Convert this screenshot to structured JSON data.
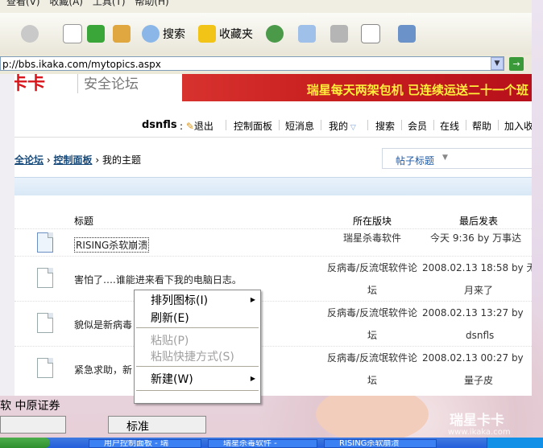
{
  "browser": {
    "toolbar": {
      "search_label": "搜索",
      "favorites_label": "收藏夹"
    },
    "address": "p://bbs.ikaka.com/mytopics.aspx",
    "address_full": "http://bbs.ikaka.com/mytopics.aspx",
    "go_label": "→"
  },
  "site": {
    "logo_red": "卡卡",
    "logo_text": "安全论坛",
    "banner_text": "瑞星每天两架包机 已连续运送二十一个班"
  },
  "nav": {
    "username": "dsnfls",
    "logout": "退出",
    "control_panel": "控制面板",
    "messages": "短消息",
    "mine": "我的",
    "search": "搜索",
    "members": "会员",
    "online": "在线",
    "help": "帮助",
    "join": "加入收"
  },
  "breadcrumb": {
    "forum": "全论坛",
    "control_panel": "控制面板",
    "current": "我的主题"
  },
  "topic_select": {
    "label": "帖子标题"
  },
  "table": {
    "headers": {
      "title": "标题",
      "forum": "所在版块",
      "last_post": "最后发表"
    },
    "rows": [
      {
        "title": "RISING杀软崩溃",
        "forum": "瑞星杀毒软件",
        "date": "今天 9:36",
        "by": "by",
        "author": "万事达",
        "forum_line2": "",
        "author_line2": ""
      },
      {
        "title": "害怕了….谁能进来看下我的电脑日志。",
        "forum": "反病毒/反流氓软件论",
        "forum_line2": "坛",
        "date": "2008.02.13 18:58",
        "by": "by",
        "author": "无",
        "author_line2": "月来了"
      },
      {
        "title": "貌似是新病毒",
        "forum": "反病毒/反流氓软件论",
        "forum_line2": "坛",
        "date": "2008.02.13 13:27",
        "by": "by",
        "author": "",
        "author_line2": "dsnfls"
      },
      {
        "title": "紧急求助，新",
        "forum": "反病毒/反流氓软件论",
        "forum_line2": "坛",
        "date": "2008.02.13 00:27",
        "by": "by",
        "author": "",
        "author_line2": "量子皮"
      }
    ]
  },
  "context_menu": {
    "arrange": "排列图标(I)",
    "refresh": "刷新(E)",
    "paste": "粘贴(P)",
    "paste_shortcut": "粘贴快捷方式(S)",
    "new": "新建(W)"
  },
  "ime": {
    "left_text": "软 中原证券",
    "mode": "标准"
  },
  "watermark": {
    "brand": "瑞星卡卡",
    "url": "www.ikaka.com"
  },
  "taskbar": {
    "tasks": [
      "用户控制面板 - 瑞",
      "瑞星杀毒软件 -",
      "RISING杀软崩溃"
    ]
  }
}
